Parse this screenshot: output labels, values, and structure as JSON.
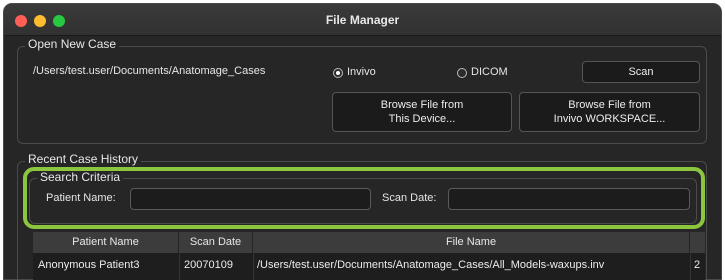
{
  "window": {
    "title": "File Manager"
  },
  "open_case": {
    "legend": "Open New Case",
    "path": "/Users/test.user/Documents/Anatomage_Cases",
    "source_options": [
      {
        "label": "Invivo",
        "selected": true
      },
      {
        "label": "DICOM",
        "selected": false
      }
    ],
    "scan_label": "Scan",
    "browse_device_line1": "Browse File from",
    "browse_device_line2": "This Device...",
    "browse_ws_line1": "Browse File from",
    "browse_ws_line2": "Invivo WORKSPACE..."
  },
  "history": {
    "legend": "Recent Case History",
    "search": {
      "legend": "Search Criteria",
      "patient_label": "Patient Name:",
      "patient_value": "",
      "date_label": "Scan Date:",
      "date_value": ""
    },
    "columns": [
      "Patient Name",
      "Scan Date",
      "File Name",
      ""
    ],
    "rows": [
      {
        "patient": "Anonymous Patient3",
        "date": "20070109",
        "file": "/Users/test.user/Documents/Anatomage_Cases/All_Models-waxups.inv",
        "extra": "2"
      }
    ]
  },
  "colors": {
    "highlight": "#8cc63f",
    "window_bg": "#262626",
    "close": "#ff5f57",
    "minimize": "#febc2e",
    "maximize": "#28c840"
  }
}
